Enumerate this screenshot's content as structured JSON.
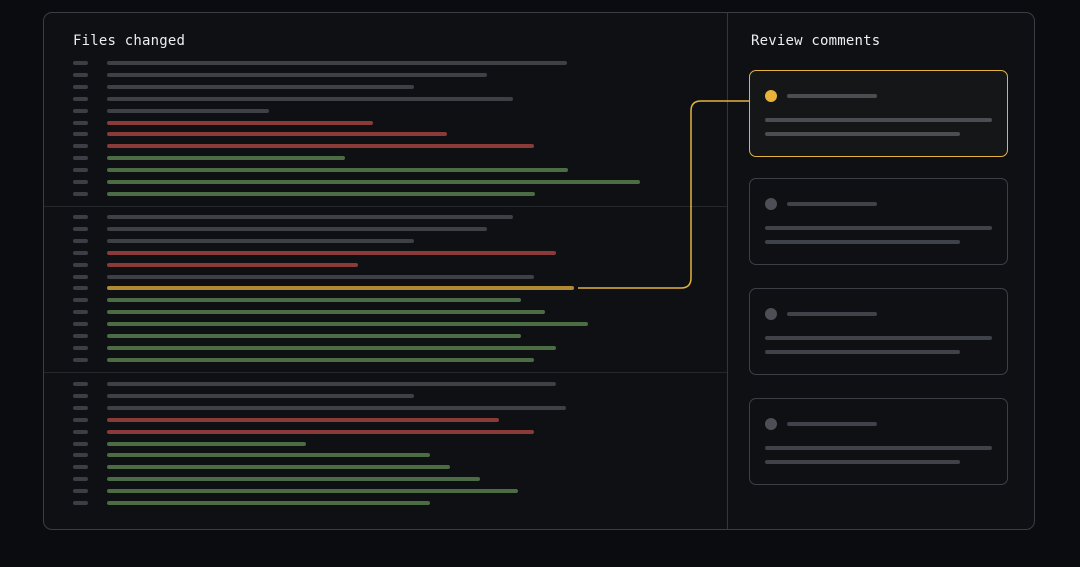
{
  "files_panel": {
    "title": "Files changed",
    "files": [
      {
        "lines": [
          "context",
          "context",
          "context",
          "context",
          "context",
          "deletion",
          "deletion",
          "deletion",
          "addition",
          "addition",
          "addition",
          "addition"
        ]
      },
      {
        "lines": [
          "context",
          "context",
          "context",
          "deletion",
          "deletion",
          "context",
          "highlighted",
          "addition",
          "addition",
          "addition",
          "addition",
          "addition",
          "addition"
        ]
      },
      {
        "lines": [
          "context",
          "context",
          "context",
          "deletion",
          "deletion",
          "addition",
          "addition",
          "addition",
          "addition",
          "addition",
          "addition"
        ]
      }
    ]
  },
  "review_panel": {
    "title": "Review comments",
    "comments": [
      {
        "active": true
      },
      {
        "active": false
      },
      {
        "active": false
      },
      {
        "active": false
      }
    ]
  },
  "colors": {
    "accent": "#e7b33a",
    "addition": "#4c6c44",
    "deletion": "#8a3a37",
    "context": "#3d4045",
    "highlight": "#b28a34"
  }
}
